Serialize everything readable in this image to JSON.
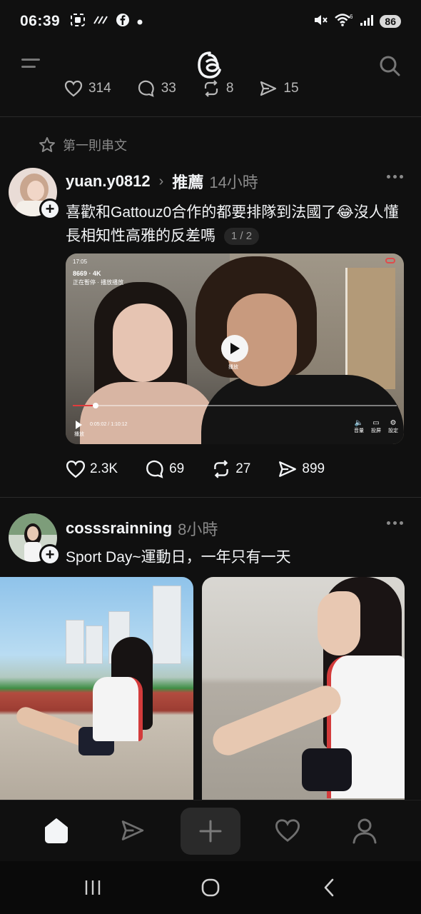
{
  "status_bar": {
    "time": "06:39",
    "left_icons": [
      "screenshot-icon",
      "wifi-calling-icon",
      "facebook-icon",
      "dot-icon"
    ],
    "right_icons": [
      "mute-icon",
      "wifi-icon",
      "signal-icon"
    ],
    "wifi_label": "6",
    "battery": "86"
  },
  "top_bar": {
    "menu_icon": "menu-icon",
    "logo": "threads-logo",
    "search_icon": "search-icon"
  },
  "previous_post_stats": {
    "likes": "314",
    "replies": "33",
    "reposts": "8",
    "shares": "15"
  },
  "pinned_label": "第一則串文",
  "post1": {
    "username": "yuan.y0812",
    "recommended": "推薦",
    "time": "14小時",
    "text": "喜歡和Gattouz0合作的都要排隊到法國了😂沒人懂長相知性高雅的反差嗎",
    "page_badge": "1 / 2",
    "video": {
      "clock": "17:05",
      "views": "8669 · 4K",
      "subtitle": "正在暫停 · 播放播放",
      "play_label": "播放",
      "current_time": "0:05:02 / 1:10:12",
      "progress": 0.07,
      "controls": [
        "音量",
        "投屏",
        "設定"
      ]
    },
    "likes": "2.3K",
    "replies": "69",
    "reposts": "27",
    "shares": "899"
  },
  "post2": {
    "username": "cosssrainning",
    "time": "8小時",
    "text": "Sport Day~運動日，一年只有一天"
  },
  "bottom_nav": {
    "items": [
      "home-icon",
      "send-icon",
      "create-icon",
      "activity-icon",
      "profile-icon"
    ]
  },
  "system_nav": {
    "items": [
      "recents-icon",
      "home-circle-icon",
      "back-icon"
    ]
  },
  "colors": {
    "background": "#101010",
    "text": "#f3f5f7",
    "secondary": "#8a8a8a",
    "accent_red": "#e23c3c"
  }
}
